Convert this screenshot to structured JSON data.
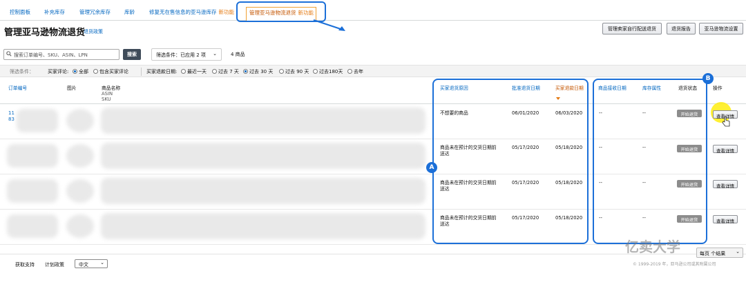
{
  "nav": {
    "items": [
      {
        "label": "控制面板"
      },
      {
        "label": "补充库存"
      },
      {
        "label": "管理冗余库存"
      },
      {
        "label": "库龄"
      },
      {
        "label": "修复无在售信息的亚马逊库存",
        "badge": "新功能"
      },
      {
        "label": "管理亚马逊物流退货",
        "badge": "新功能"
      }
    ]
  },
  "header": {
    "title": "管理亚马逊物流退货",
    "policy_link": "退货政策",
    "buttons": [
      "管理卖家自行配送退货",
      "退货报告",
      "亚马逊物流设置"
    ]
  },
  "search": {
    "placeholder": "搜索订单编号、SKU、ASIN、LPN",
    "button": "搜索",
    "filter_dropdown": "筛选条件：已应用 2 项",
    "items_count": "4 商品"
  },
  "filters": {
    "label": "筛选条件：",
    "buyer_review_label": "买家评论:",
    "buyer_review_options": [
      "全部",
      "包含买家评论"
    ],
    "date_label": "买家退款日期:",
    "date_options": [
      "最近一天",
      "过去 7 天",
      "过去 30 天",
      "过去 90 天",
      "过去180天",
      "去年"
    ]
  },
  "table": {
    "headers": {
      "order_id": "订单编号",
      "image": "图片",
      "product_name": "商品名称",
      "asin": "ASIN",
      "sku": "SKU",
      "return_reason": "买家退货原因",
      "approve_date": "批准退货日期",
      "refund_date": "买家退款日期",
      "receive_date": "商品接收日期",
      "inventory_attr": "库存属性",
      "return_status": "退货状态",
      "action": "操作"
    },
    "rows": [
      {
        "order_id_1": "11",
        "order_id_2": "83",
        "reason": "不想要的商品",
        "approve": "06/01/2020",
        "refund": "06/03/2020",
        "receive": "--",
        "attr": "--",
        "status": "开始退货",
        "action": "查看详情"
      },
      {
        "order_id_1": "",
        "order_id_2": "",
        "reason": "商品未在预计的交货日期前送达",
        "approve": "05/17/2020",
        "refund": "05/18/2020",
        "receive": "--",
        "attr": "--",
        "status": "开始退货",
        "action": "查看详情"
      },
      {
        "order_id_1": "",
        "order_id_2": "",
        "reason": "商品未在预计的交货日期前送达",
        "approve": "05/17/2020",
        "refund": "05/18/2020",
        "receive": "--",
        "attr": "--",
        "status": "开始退货",
        "action": "查看详情"
      },
      {
        "order_id_1": "",
        "order_id_2": "",
        "reason": "商品未在预计的交货日期前送达",
        "approve": "05/17/2020",
        "refund": "05/18/2020",
        "receive": "--",
        "attr": "--",
        "status": "开始退货",
        "action": "查看详情"
      }
    ]
  },
  "annotations": {
    "a": "A",
    "b": "B"
  },
  "footer": {
    "support": "获取支持",
    "program_policy": "计划政策",
    "language": "中文",
    "per_page": "每页 个结果",
    "copyright": "© 1999-2019 年，亚马逊公司或其附属公司",
    "watermark": "亿卖大学"
  },
  "colors": {
    "link": "#0066c0",
    "accent": "#e47911",
    "annotation": "#1b6fd8"
  }
}
